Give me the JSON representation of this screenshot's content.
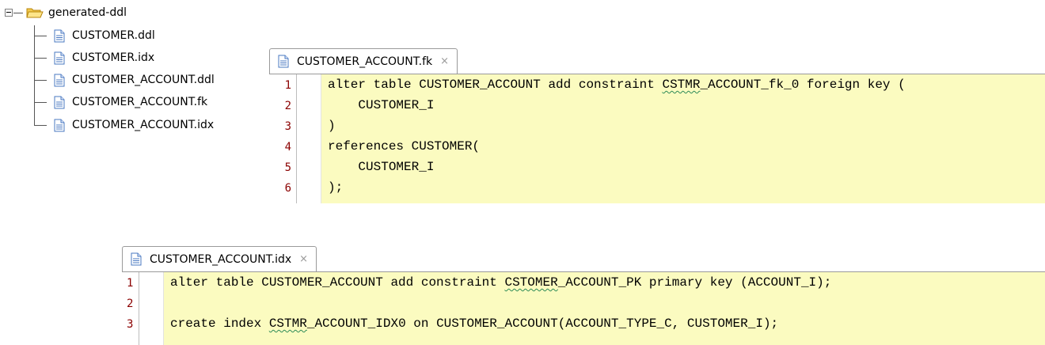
{
  "tree": {
    "root": {
      "label": "generated-ddl",
      "icon": "folder-open-icon"
    },
    "items": [
      {
        "label": "CUSTOMER.ddl",
        "icon": "file-icon"
      },
      {
        "label": "CUSTOMER.idx",
        "icon": "file-icon"
      },
      {
        "label": "CUSTOMER_ACCOUNT.ddl",
        "icon": "file-icon"
      },
      {
        "label": "CUSTOMER_ACCOUNT.fk",
        "icon": "file-icon"
      },
      {
        "label": "CUSTOMER_ACCOUNT.idx",
        "icon": "file-icon"
      }
    ]
  },
  "editors": [
    {
      "tab": {
        "label": "CUSTOMER_ACCOUNT.fk",
        "close": "×"
      },
      "lines": [
        {
          "num": "1",
          "segments": [
            {
              "text": "alter table CUSTOMER_ACCOUNT add constraint "
            },
            {
              "text": "CSTMR",
              "squiggle": true
            },
            {
              "text": "_ACCOUNT_fk_0 foreign key ("
            }
          ]
        },
        {
          "num": "2",
          "segments": [
            {
              "text": "    CUSTOMER_I"
            }
          ]
        },
        {
          "num": "3",
          "segments": [
            {
              "text": ")"
            }
          ]
        },
        {
          "num": "4",
          "segments": [
            {
              "text": "references CUSTOMER("
            }
          ]
        },
        {
          "num": "5",
          "segments": [
            {
              "text": "    CUSTOMER_I"
            }
          ]
        },
        {
          "num": "6",
          "segments": [
            {
              "text": ");"
            }
          ]
        }
      ]
    },
    {
      "tab": {
        "label": "CUSTOMER_ACCOUNT.idx",
        "close": "×"
      },
      "lines": [
        {
          "num": "1",
          "segments": [
            {
              "text": "alter table CUSTOMER_ACCOUNT add constraint "
            },
            {
              "text": "CSTOMER",
              "squiggle": true
            },
            {
              "text": "_ACCOUNT_PK primary key (ACCOUNT_I);"
            }
          ]
        },
        {
          "num": "2",
          "segments": [
            {
              "text": ""
            }
          ]
        },
        {
          "num": "3",
          "segments": [
            {
              "text": "create index "
            },
            {
              "text": "CSTMR",
              "squiggle": true
            },
            {
              "text": "_ACCOUNT_IDX0 on CUSTOMER_ACCOUNT(ACCOUNT_TYPE_C, CUSTOMER_I);"
            }
          ]
        }
      ]
    }
  ],
  "colors": {
    "code_background": "#fbfbc0",
    "line_number": "#8b0000",
    "spellcheck_squiggle": "#2e8b57"
  }
}
